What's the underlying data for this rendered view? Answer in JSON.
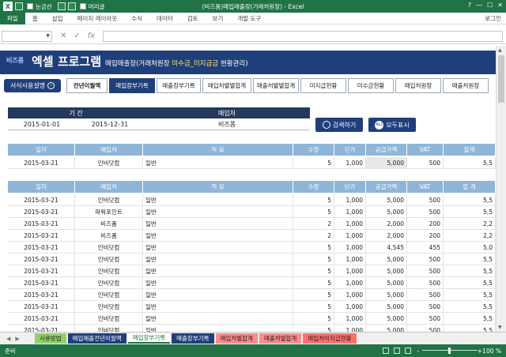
{
  "window": {
    "title": "(비즈폼)매입매출장(거래처원장) - Excel",
    "qat_label1": "눈금선",
    "qat_label2": "머리글",
    "controls": [
      "?",
      "—",
      "☐",
      "✕"
    ]
  },
  "ribbon": {
    "file": "파일",
    "tabs": [
      "홈",
      "삽입",
      "페이지 레이아웃",
      "수식",
      "데이터",
      "검토",
      "보기",
      "개발 도구"
    ],
    "user": "로그인"
  },
  "formula": {
    "fx": "fx",
    "cancel": "✕",
    "enter": "✓"
  },
  "banner": {
    "brand": "비즈폼",
    "program": "엑셀 프로그램",
    "subtitle_a": "매입매출장(거래처원장 ",
    "subtitle_b": "미수금_미지급금",
    "subtitle_c": " 현황관리)"
  },
  "help_button": "서식사용설명",
  "nav": [
    "전년이월액",
    "매입장부기록",
    "매출장부기록",
    "매입처별별합계",
    "매출처별별합계",
    "미지급현황",
    "미수금현황",
    "매입처원장",
    "매출처원장"
  ],
  "filter": {
    "period_label": "기 간",
    "vendor_label": "매입처",
    "from": "2015-01-01",
    "to": "2015-12-31",
    "vendor": "비즈폼",
    "search_btn": "검색하기",
    "showall_btn": "모두표시",
    "all_icon": "ALL"
  },
  "columns": [
    "일자",
    "매입처",
    "적        요",
    "수량",
    "단가",
    "공급가액",
    "VAT",
    "합계"
  ],
  "columns2": [
    "일자",
    "매입처",
    "적        요",
    "수량",
    "단가",
    "공급가액",
    "VAT",
    "합  계"
  ],
  "summary": [
    "2015-03-21",
    "인비닷컴",
    "일반",
    "5",
    "1,000",
    "5,000",
    "500",
    "5,5"
  ],
  "rows": [
    [
      "2015-03-21",
      "인비닷컴",
      "일반",
      "5",
      "1,000",
      "5,000",
      "500",
      "5,5"
    ],
    [
      "2015-03-21",
      "파워포인트",
      "일반",
      "5",
      "1,000",
      "5,000",
      "500",
      "5,5"
    ],
    [
      "2015-03-21",
      "비즈폼",
      "일반",
      "2",
      "1,000",
      "2,000",
      "200",
      "2,2"
    ],
    [
      "2015-03-21",
      "비즈폼",
      "일반",
      "2",
      "1,000",
      "2,000",
      "200",
      "2,2"
    ],
    [
      "2015-03-21",
      "인비닷컴",
      "일반",
      "5",
      "1,000",
      "4,545",
      "455",
      "5,0"
    ],
    [
      "2015-03-21",
      "인비닷컴",
      "일반",
      "5",
      "1,000",
      "5,000",
      "500",
      "5,5"
    ],
    [
      "2015-03-21",
      "인비닷컴",
      "일반",
      "5",
      "1,000",
      "5,000",
      "500",
      "5,5"
    ],
    [
      "2015-03-21",
      "인비닷컴",
      "일반",
      "5",
      "1,000",
      "5,000",
      "500",
      "5,5"
    ],
    [
      "2015-03-21",
      "인비닷컴",
      "일반",
      "5",
      "1,000",
      "5,000",
      "500",
      "5,5"
    ],
    [
      "2015-03-21",
      "인비닷컴",
      "일반",
      "5",
      "1,000",
      "5,000",
      "500",
      "5,5"
    ],
    [
      "2015-03-21",
      "인비닷컴",
      "일반",
      "5",
      "1,000",
      "5,000",
      "500",
      "5,5"
    ],
    [
      "2015-03-21",
      "인비닷컴",
      "일반",
      "5",
      "1,000",
      "5,000",
      "500",
      "5,5"
    ]
  ],
  "sheet_tabs": [
    "사용방법",
    "매입매출전년이월액",
    "매입장부기록",
    "매출장부기록",
    "매입처별합계",
    "매출처별합계",
    "매입처미지급현황"
  ],
  "status": {
    "ready": "준비",
    "zoom": "100 %",
    "minus": "-",
    "plus": "+"
  }
}
